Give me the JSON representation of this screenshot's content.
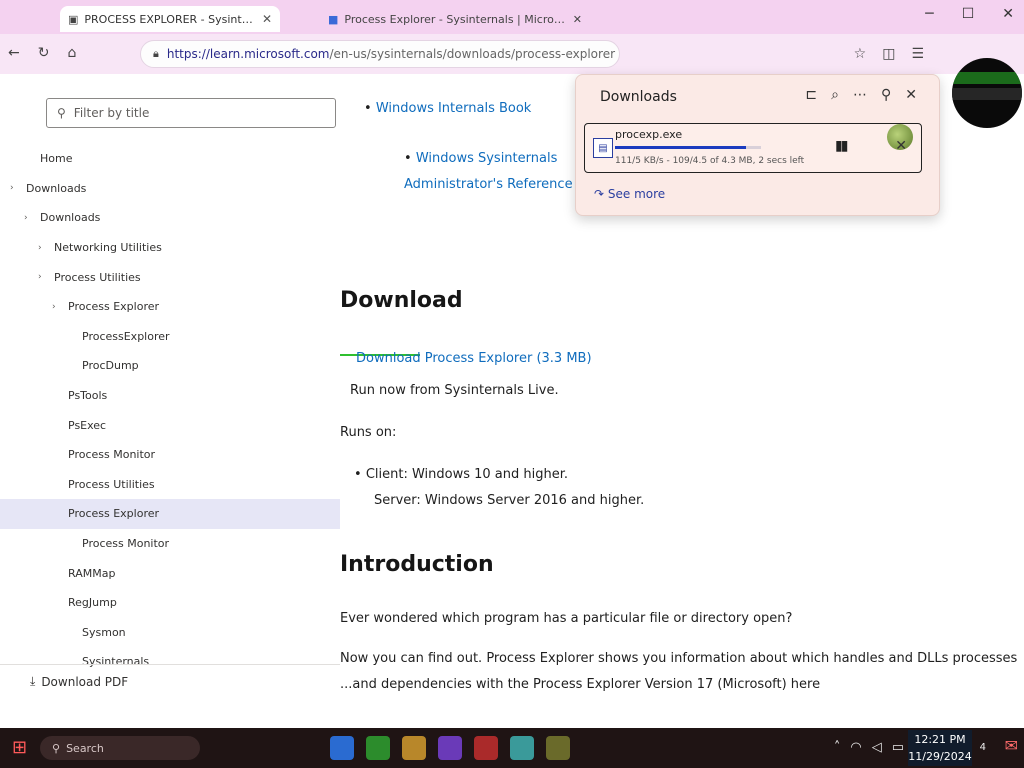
{
  "browser": {
    "tabs": [
      {
        "label": "PROCESS EXPLORER - Sysinternals"
      },
      {
        "label": "Process Explorer - Sysinternals | Microsoft Learn"
      }
    ],
    "url_host": "https://learn.microsoft.com",
    "url_path": "/en-us/sysinternals/downloads/process-explorer"
  },
  "sidebar": {
    "filter_placeholder": "Filter by title",
    "items": [
      {
        "label": "Home",
        "indent": 1,
        "chevron": false
      },
      {
        "label": "Downloads",
        "indent": 0,
        "chevron": true
      },
      {
        "label": "Downloads",
        "indent": 1,
        "chevron": true
      },
      {
        "label": "Networking Utilities",
        "indent": 2,
        "chevron": true
      },
      {
        "label": "Process Utilities",
        "indent": 2,
        "chevron": true
      },
      {
        "label": "Process Explorer",
        "indent": 3,
        "chevron": true
      },
      {
        "label": "ProcessExplorer",
        "indent": 4,
        "chevron": false
      },
      {
        "label": "ProcDump",
        "indent": 4,
        "chevron": false
      },
      {
        "label": "PsTools",
        "indent": 3,
        "chevron": false
      },
      {
        "label": "PsExec",
        "indent": 3,
        "chevron": false
      },
      {
        "label": "Process Monitor",
        "indent": 3,
        "chevron": false
      },
      {
        "label": "Process Utilities",
        "indent": 3,
        "chevron": false
      },
      {
        "label": "Process Explorer",
        "indent": 3,
        "chevron": false,
        "selected": true
      },
      {
        "label": "Process Monitor",
        "indent": 4,
        "chevron": false
      },
      {
        "label": "RAMMap",
        "indent": 3,
        "chevron": false
      },
      {
        "label": "RegJump",
        "indent": 3,
        "chevron": false
      },
      {
        "label": "Sysmon",
        "indent": 4,
        "chevron": false
      },
      {
        "label": "Sysinternals",
        "indent": 4,
        "chevron": false
      }
    ],
    "footer_label": "Download PDF"
  },
  "main": {
    "bullets": [
      "Windows Internals Book",
      "Windows Sysinternals Administrator's Reference"
    ],
    "section1_title": "Download",
    "download_link": "Download Process Explorer (3.3 MB)",
    "run_now": "Run now from Sysinternals Live.",
    "section2_line1": "Runs on:",
    "runs_on_bullet": "Client: Windows 10 and higher.",
    "runs_on_bullet2": "Server: Windows Server 2016 and higher.",
    "section2_title": "Introduction",
    "intro_line1": "Ever wondered which program has a particular file or directory open?",
    "intro_line2": "Now you can find out. Process Explorer shows you information about which handles and DLLs processes have opened or loaded.",
    "intro_line3": "...and dependencies with the Process Explorer Version 17 (Microsoft) here"
  },
  "downloads": {
    "title": "Downloads",
    "file_name": "procexp.exe",
    "progress": 0.9,
    "status": "111/5 KB/s - 109/4.5 of 4.3 MB, 2 secs left",
    "see_more": "See more"
  },
  "taskbar": {
    "search_placeholder": "Search",
    "time": "12:21 PM",
    "date": "11/29/2024",
    "notif_count": "4"
  },
  "colors": {
    "title_bar": "#f4d2f0",
    "address_row": "#f8e6f6",
    "link": "#0f6cbd",
    "taskbar": "#1f1414",
    "download_panel": "#fbeae6"
  }
}
